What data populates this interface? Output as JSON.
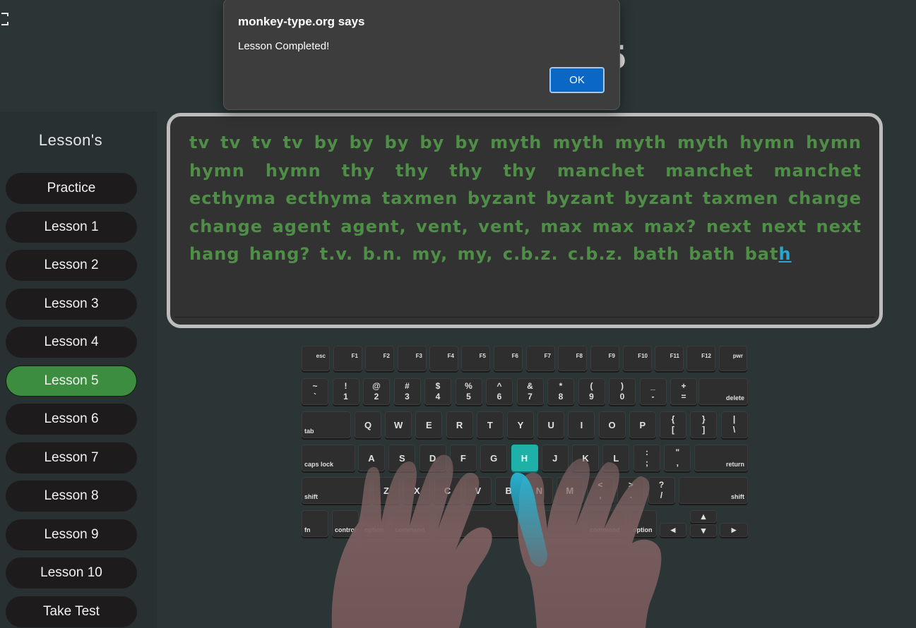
{
  "page": {
    "title": "Lesson-5"
  },
  "sidebar": {
    "title": "Lesson's",
    "items": [
      {
        "label": "Practice"
      },
      {
        "label": "Lesson 1"
      },
      {
        "label": "Lesson 2"
      },
      {
        "label": "Lesson 3"
      },
      {
        "label": "Lesson 4"
      },
      {
        "label": "Lesson 5",
        "active": true
      },
      {
        "label": "Lesson 6"
      },
      {
        "label": "Lesson 7"
      },
      {
        "label": "Lesson 8"
      },
      {
        "label": "Lesson 9"
      },
      {
        "label": "Lesson 10"
      },
      {
        "label": "Take Test"
      }
    ]
  },
  "lesson": {
    "typed_text": "tv tv tv tv by by by by by myth myth myth myth hymn hymn hymn hymn thy thy thy thy manchet manchet manchet ecthyma ecthyma taxmen byzant byzant byzant taxmen change change agent agent, vent, vent, max max max? next next next hang hang? t.v. b.n. my, my, c.b.z. c.b.z. bath bath bat",
    "current_char": "h",
    "typed_color": "#4e8e46",
    "cursor_color": "#2aa5cf"
  },
  "keyboard": {
    "active_key": "H",
    "active_color": "#1fb1a7",
    "function_row": [
      "esc",
      "F1",
      "F2",
      "F3",
      "F4",
      "F5",
      "F6",
      "F7",
      "F8",
      "F9",
      "F10",
      "F11",
      "F12",
      "pwr"
    ],
    "number_row": [
      {
        "top": "~",
        "bottom": "`"
      },
      {
        "top": "!",
        "bottom": "1"
      },
      {
        "top": "@",
        "bottom": "2"
      },
      {
        "top": "#",
        "bottom": "3"
      },
      {
        "top": "$",
        "bottom": "4"
      },
      {
        "top": "%",
        "bottom": "5"
      },
      {
        "top": "^",
        "bottom": "6"
      },
      {
        "top": "&",
        "bottom": "7"
      },
      {
        "top": "*",
        "bottom": "8"
      },
      {
        "top": "(",
        "bottom": "9"
      },
      {
        "top": ")",
        "bottom": "0"
      },
      {
        "top": "_",
        "bottom": "-"
      },
      {
        "top": "+",
        "bottom": "="
      }
    ],
    "delete": "delete",
    "tab": "tab",
    "top_row": [
      "Q",
      "W",
      "E",
      "R",
      "T",
      "Y",
      "U",
      "I",
      "O",
      "P"
    ],
    "top_row_symbols": [
      {
        "top": "{",
        "bottom": "["
      },
      {
        "top": "}",
        "bottom": "]"
      },
      {
        "top": "|",
        "bottom": "\\"
      }
    ],
    "caps": "caps lock",
    "home_row": [
      "A",
      "S",
      "D",
      "F",
      "G",
      "H",
      "J",
      "K",
      "L"
    ],
    "home_row_symbols": [
      {
        "top": ":",
        "bottom": ";"
      },
      {
        "top": "\"",
        "bottom": ","
      }
    ],
    "return": "return",
    "shift": "shift",
    "bottom_row": [
      "Z",
      "X",
      "C",
      "V",
      "B",
      "N",
      "M"
    ],
    "bottom_row_symbols": [
      {
        "top": "<",
        "bottom": ","
      },
      {
        "top": ">",
        "bottom": "."
      },
      {
        "top": "?",
        "bottom": "/"
      }
    ],
    "modifiers": {
      "fn": "fn",
      "control": "control",
      "option": "option",
      "command": "command"
    },
    "arrows": {
      "left": "◂",
      "up": "▴",
      "down": "▾",
      "right": "▸"
    }
  },
  "alert": {
    "title": "monkey-type.org says",
    "message": "Lesson Completed!",
    "ok": "OK"
  }
}
